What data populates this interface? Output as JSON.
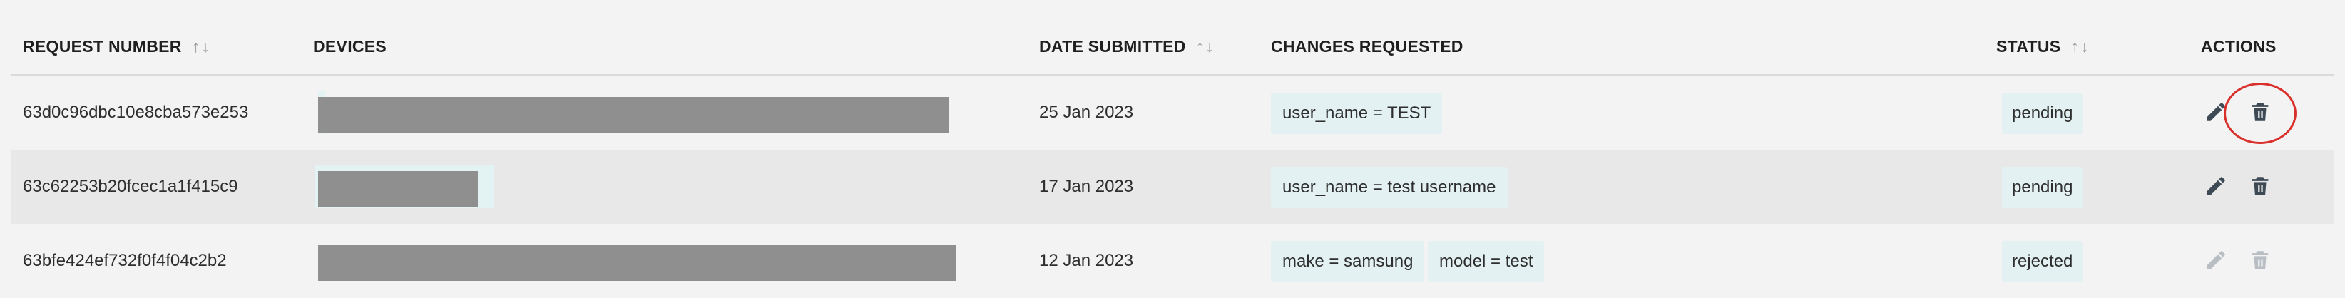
{
  "headers": {
    "request_number": "REQUEST NUMBER",
    "devices": "DEVICES",
    "date_submitted": "DATE SUBMITTED",
    "changes_requested": "CHANGES REQUESTED",
    "status": "STATUS",
    "actions": "ACTIONS",
    "sort_glyph": "↑↓"
  },
  "rows": [
    {
      "request_number": "63d0c96dbc10e8cba573e253",
      "device_redacted": true,
      "date": "25 Jan 2023",
      "changes": [
        "user_name = TEST"
      ],
      "status": "pending",
      "actions_enabled": true
    },
    {
      "request_number": "63c62253b20fcec1a1f415c9",
      "device_redacted": true,
      "date": "17 Jan 2023",
      "changes": [
        "user_name = test username"
      ],
      "status": "pending",
      "actions_enabled": true
    },
    {
      "request_number": "63bfe424ef732f0f4f04c2b2",
      "device_redacted": true,
      "date": "12 Jan 2023",
      "changes": [
        "make = samsung",
        "model = test"
      ],
      "status": "rejected",
      "actions_enabled": false
    }
  ],
  "icons": {
    "edit": "pencil-icon",
    "delete": "trash-icon"
  },
  "colors": {
    "chip_bg": "#e3f1f2",
    "redaction": "#8f8f8f",
    "alt_row": "#e8e8e8",
    "icon_active": "#3d4a55",
    "icon_disabled": "#b8bec3",
    "highlight": "#d9302c"
  }
}
